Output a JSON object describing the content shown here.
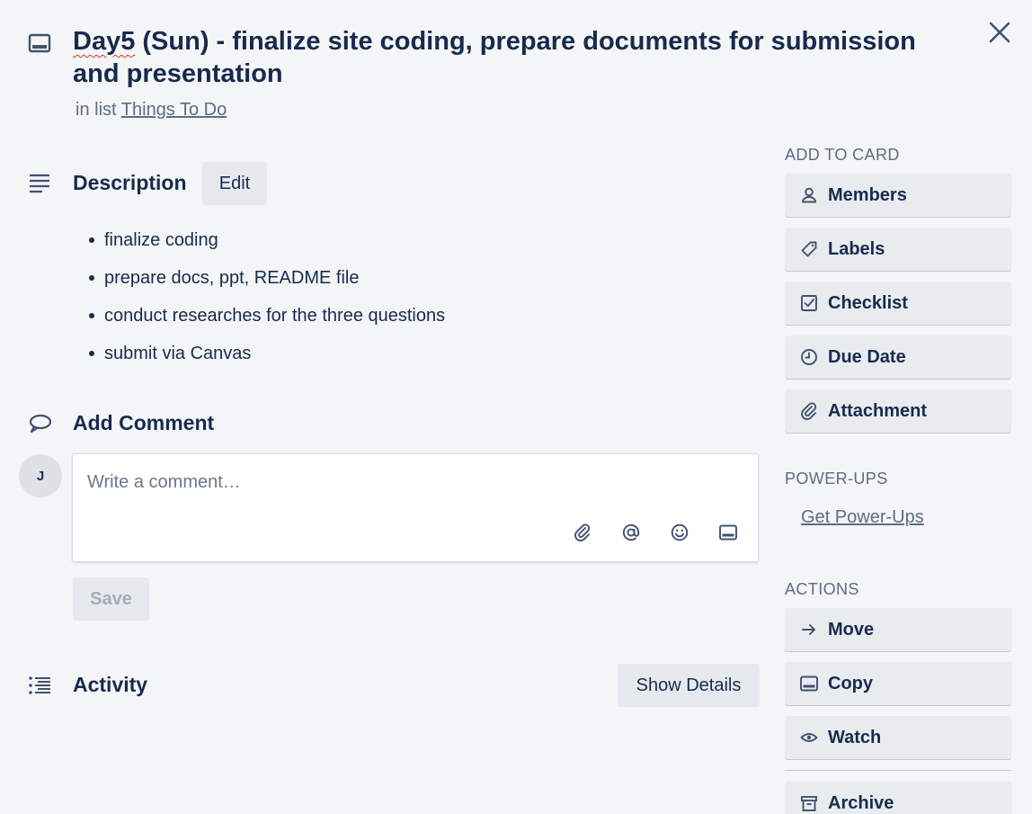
{
  "card": {
    "title_first_word": "Day5",
    "title_rest": " (Sun) - finalize site coding, prepare documents for submission and presentation",
    "in_list_prefix": "in list",
    "list_name": "Things To Do"
  },
  "description": {
    "heading": "Description",
    "edit_label": "Edit",
    "items": [
      "finalize coding",
      "prepare docs, ppt, README file",
      "conduct researches for the three questions",
      "submit via Canvas"
    ]
  },
  "comment": {
    "heading": "Add Comment",
    "avatar_initial": "J",
    "placeholder": "Write a comment…",
    "save_label": "Save"
  },
  "activity": {
    "heading": "Activity",
    "show_details_label": "Show Details"
  },
  "sidebar": {
    "add_to_card_heading": "ADD TO CARD",
    "add_to_card": [
      {
        "label": "Members",
        "icon": "person-icon"
      },
      {
        "label": "Labels",
        "icon": "tag-icon"
      },
      {
        "label": "Checklist",
        "icon": "checkbox-icon"
      },
      {
        "label": "Due Date",
        "icon": "clock-icon"
      },
      {
        "label": "Attachment",
        "icon": "paperclip-icon"
      }
    ],
    "power_ups_heading": "POWER-UPS",
    "get_power_ups": "Get Power-Ups",
    "actions_heading": "ACTIONS",
    "actions": [
      {
        "label": "Move",
        "icon": "arrow-right-icon"
      },
      {
        "label": "Copy",
        "icon": "card-icon"
      },
      {
        "label": "Watch",
        "icon": "eye-icon"
      },
      {
        "label": "Archive",
        "icon": "archive-icon"
      }
    ]
  },
  "colors": {
    "background": "#f4f5f7",
    "text_primary": "#172b4d",
    "text_subtle": "#5e6c84",
    "button_bg": "#e6e9ed"
  }
}
